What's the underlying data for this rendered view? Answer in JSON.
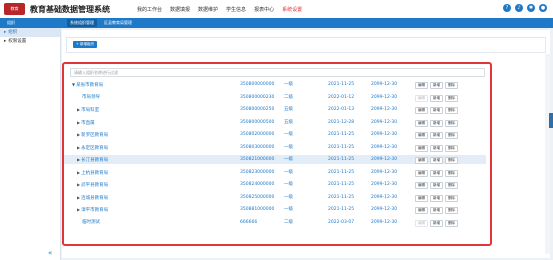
{
  "header": {
    "logo_text": "教育",
    "app_title": "教育基础数据管理系统",
    "nav": [
      "我的工作台",
      "数据填报",
      "数据维护",
      "学生信息",
      "报表中心",
      "系统设置"
    ],
    "active_nav": 5
  },
  "tabs": [
    {
      "label": "组织",
      "active": false
    },
    {
      "label": "系统组织管理",
      "active": true
    },
    {
      "label": "区县教育局管理",
      "active": false
    }
  ],
  "sidebar": {
    "items": [
      {
        "label": "组织",
        "selected": true
      },
      {
        "label": "权限设置",
        "selected": false
      }
    ],
    "collapse": "«"
  },
  "toolbar": {
    "add_label": "+ 新增组织"
  },
  "search": {
    "placeholder": "请输入组织名称进行过滤"
  },
  "actions": {
    "edit": "编辑",
    "add": "新增",
    "delete": "删除"
  },
  "rows": [
    {
      "name": "某省市教育局",
      "code": "350800000000",
      "level": "一级",
      "start": "2021-11-25",
      "end": "2099-12-30",
      "expander": "▼",
      "indent": 0,
      "highlight": false,
      "edit_disabled": false
    },
    {
      "name": "市局领导",
      "code": "350800000230",
      "level": "二级",
      "start": "2022-01-12",
      "end": "2099-12-30",
      "expander": "",
      "indent": 2,
      "highlight": false,
      "edit_disabled": true
    },
    {
      "name": "市局科室",
      "code": "350800000250",
      "level": "五级",
      "start": "2022-01-13",
      "end": "2099-12-30",
      "expander": "▶",
      "indent": 1,
      "highlight": false,
      "edit_disabled": false
    },
    {
      "name": "市直属",
      "code": "350800000500",
      "level": "五级",
      "start": "2021-12-28",
      "end": "2099-12-30",
      "expander": "▶",
      "indent": 1,
      "highlight": false,
      "edit_disabled": false
    },
    {
      "name": "新罗区教育局",
      "code": "350802000000",
      "level": "一级",
      "start": "2021-11-25",
      "end": "2099-12-30",
      "expander": "▶",
      "indent": 1,
      "highlight": false,
      "edit_disabled": false
    },
    {
      "name": "永定区教育局",
      "code": "350803000000",
      "level": "一级",
      "start": "2021-11-25",
      "end": "2099-12-30",
      "expander": "▶",
      "indent": 1,
      "highlight": false,
      "edit_disabled": false
    },
    {
      "name": "长汀县教育局",
      "code": "350821000000",
      "level": "一级",
      "start": "2021-11-25",
      "end": "2099-12-30",
      "expander": "▶",
      "indent": 1,
      "highlight": true,
      "edit_disabled": false
    },
    {
      "name": "上杭县教育局",
      "code": "350823000000",
      "level": "一级",
      "start": "2021-11-25",
      "end": "2099-12-30",
      "expander": "▶",
      "indent": 1,
      "highlight": false,
      "edit_disabled": false
    },
    {
      "name": "武平县教育局",
      "code": "350824000000",
      "level": "一级",
      "start": "2021-11-25",
      "end": "2099-12-30",
      "expander": "▶",
      "indent": 1,
      "highlight": false,
      "edit_disabled": false
    },
    {
      "name": "连城县教育局",
      "code": "350825000000",
      "level": "一级",
      "start": "2021-11-25",
      "end": "2099-12-30",
      "expander": "▶",
      "indent": 1,
      "highlight": false,
      "edit_disabled": false
    },
    {
      "name": "漳平市教育局",
      "code": "350881000000",
      "level": "一级",
      "start": "2021-11-25",
      "end": "2099-12-30",
      "expander": "▶",
      "indent": 1,
      "highlight": false,
      "edit_disabled": false
    },
    {
      "name": "临时测试",
      "code": "666666",
      "level": "二级",
      "start": "2022-03-07",
      "end": "2099-12-30",
      "expander": "",
      "indent": 2,
      "highlight": false,
      "edit_disabled": true
    }
  ]
}
